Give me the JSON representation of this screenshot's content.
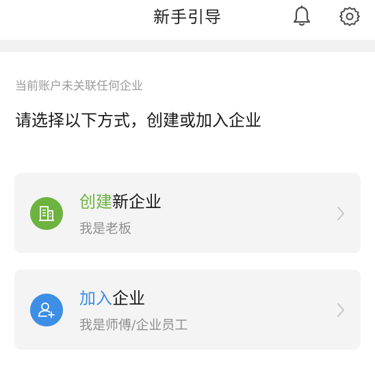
{
  "header": {
    "title": "新手引导",
    "bell_icon": "bell-icon",
    "settings_icon": "gear-icon"
  },
  "intro": {
    "subtitle": "当前账户未关联任何企业",
    "headline": "请选择以下方式，创建或加入企业"
  },
  "options": [
    {
      "icon": "building-icon",
      "icon_color": "#6db33f",
      "title_accent": "创建",
      "title_rest": "新企业",
      "description": "我是老板"
    },
    {
      "icon": "add-user-icon",
      "icon_color": "#3d8ee6",
      "title_accent": "加入",
      "title_rest": "企业",
      "description": "我是师傅/企业员工"
    }
  ],
  "colors": {
    "create_accent": "#6db33f",
    "join_accent": "#3d8ee6",
    "card_background": "#f4f4f4",
    "divider": "#f2f2f2"
  }
}
